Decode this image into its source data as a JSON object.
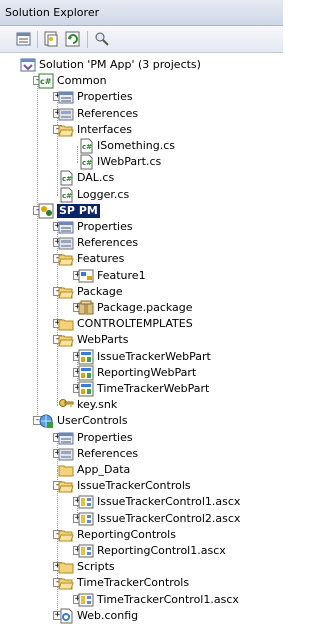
{
  "window": {
    "title": "Solution Explorer"
  },
  "toolbar": {
    "buttons": [
      {
        "name": "properties-button",
        "icon": "properties-icon"
      },
      {
        "name": "show-all-files-button",
        "icon": "show-all-files-icon"
      },
      {
        "name": "refresh-button",
        "icon": "refresh-icon"
      },
      {
        "name": "view-class-diagram-button",
        "icon": "class-diagram-icon"
      }
    ]
  },
  "tree": {
    "items": [
      {
        "label": "Solution 'PM App' (3 projects)",
        "icon": "solution-icon",
        "level": 0,
        "expander": ""
      },
      {
        "label": "Common",
        "icon": "csharp-project-icon",
        "level": 1,
        "expander": "-"
      },
      {
        "label": "Properties",
        "icon": "properties-folder-icon",
        "level": 2,
        "expander": "+"
      },
      {
        "label": "References",
        "icon": "references-icon",
        "level": 2,
        "expander": "+"
      },
      {
        "label": "Interfaces",
        "icon": "folder-open-icon",
        "level": 2,
        "expander": "-"
      },
      {
        "label": "ISomething.cs",
        "icon": "csharp-file-icon",
        "level": 3,
        "expander": ""
      },
      {
        "label": "IWebPart.cs",
        "icon": "csharp-file-icon",
        "level": 3,
        "expander": ""
      },
      {
        "label": "DAL.cs",
        "icon": "csharp-file-icon",
        "level": 2,
        "expander": ""
      },
      {
        "label": "Logger.cs",
        "icon": "csharp-file-icon",
        "level": 2,
        "expander": ""
      },
      {
        "label": "SP PM",
        "icon": "sharepoint-project-icon",
        "level": 1,
        "expander": "-",
        "selected": true
      },
      {
        "label": "Properties",
        "icon": "properties-folder-icon",
        "level": 2,
        "expander": "+"
      },
      {
        "label": "References",
        "icon": "references-icon",
        "level": 2,
        "expander": "+"
      },
      {
        "label": "Features",
        "icon": "folder-open-icon",
        "level": 2,
        "expander": "-"
      },
      {
        "label": "Feature1",
        "icon": "feature-icon",
        "level": 3,
        "expander": "+"
      },
      {
        "label": "Package",
        "icon": "folder-open-icon",
        "level": 2,
        "expander": "-"
      },
      {
        "label": "Package.package",
        "icon": "package-icon",
        "level": 3,
        "expander": "+"
      },
      {
        "label": "CONTROLTEMPLATES",
        "icon": "folder-icon",
        "level": 2,
        "expander": "+"
      },
      {
        "label": "WebParts",
        "icon": "folder-open-icon",
        "level": 2,
        "expander": "-"
      },
      {
        "label": "IssueTrackerWebPart",
        "icon": "webpart-icon",
        "level": 3,
        "expander": "+"
      },
      {
        "label": "ReportingWebPart",
        "icon": "webpart-icon",
        "level": 3,
        "expander": "+"
      },
      {
        "label": "TimeTrackerWebPart",
        "icon": "webpart-icon",
        "level": 3,
        "expander": "+"
      },
      {
        "label": "key.snk",
        "icon": "key-icon",
        "level": 2,
        "expander": ""
      },
      {
        "label": "UserControls",
        "icon": "web-project-icon",
        "level": 1,
        "expander": "-"
      },
      {
        "label": "Properties",
        "icon": "properties-folder-icon",
        "level": 2,
        "expander": "+"
      },
      {
        "label": "References",
        "icon": "references-icon",
        "level": 2,
        "expander": "+"
      },
      {
        "label": "App_Data",
        "icon": "folder-icon",
        "level": 2,
        "expander": ""
      },
      {
        "label": "IssueTrackerControls",
        "icon": "folder-open-icon",
        "level": 2,
        "expander": "-"
      },
      {
        "label": "IssueTrackerControl1.ascx",
        "icon": "ascx-icon",
        "level": 3,
        "expander": "+"
      },
      {
        "label": "IssueTrackerControl2.ascx",
        "icon": "ascx-icon",
        "level": 3,
        "expander": "+"
      },
      {
        "label": "ReportingControls",
        "icon": "folder-open-icon",
        "level": 2,
        "expander": "-"
      },
      {
        "label": "ReportingControl1.ascx",
        "icon": "ascx-icon",
        "level": 3,
        "expander": "+"
      },
      {
        "label": "Scripts",
        "icon": "folder-icon",
        "level": 2,
        "expander": "+"
      },
      {
        "label": "TimeTrackerControls",
        "icon": "folder-open-icon",
        "level": 2,
        "expander": "-"
      },
      {
        "label": "TimeTrackerControl1.ascx",
        "icon": "ascx-icon",
        "level": 3,
        "expander": "+"
      },
      {
        "label": "Web.config",
        "icon": "config-icon",
        "level": 2,
        "expander": "+"
      }
    ]
  },
  "colors": {
    "selection": "#0a246a",
    "folder": "#f3d37a",
    "titlebar": "#cfd7e6"
  }
}
